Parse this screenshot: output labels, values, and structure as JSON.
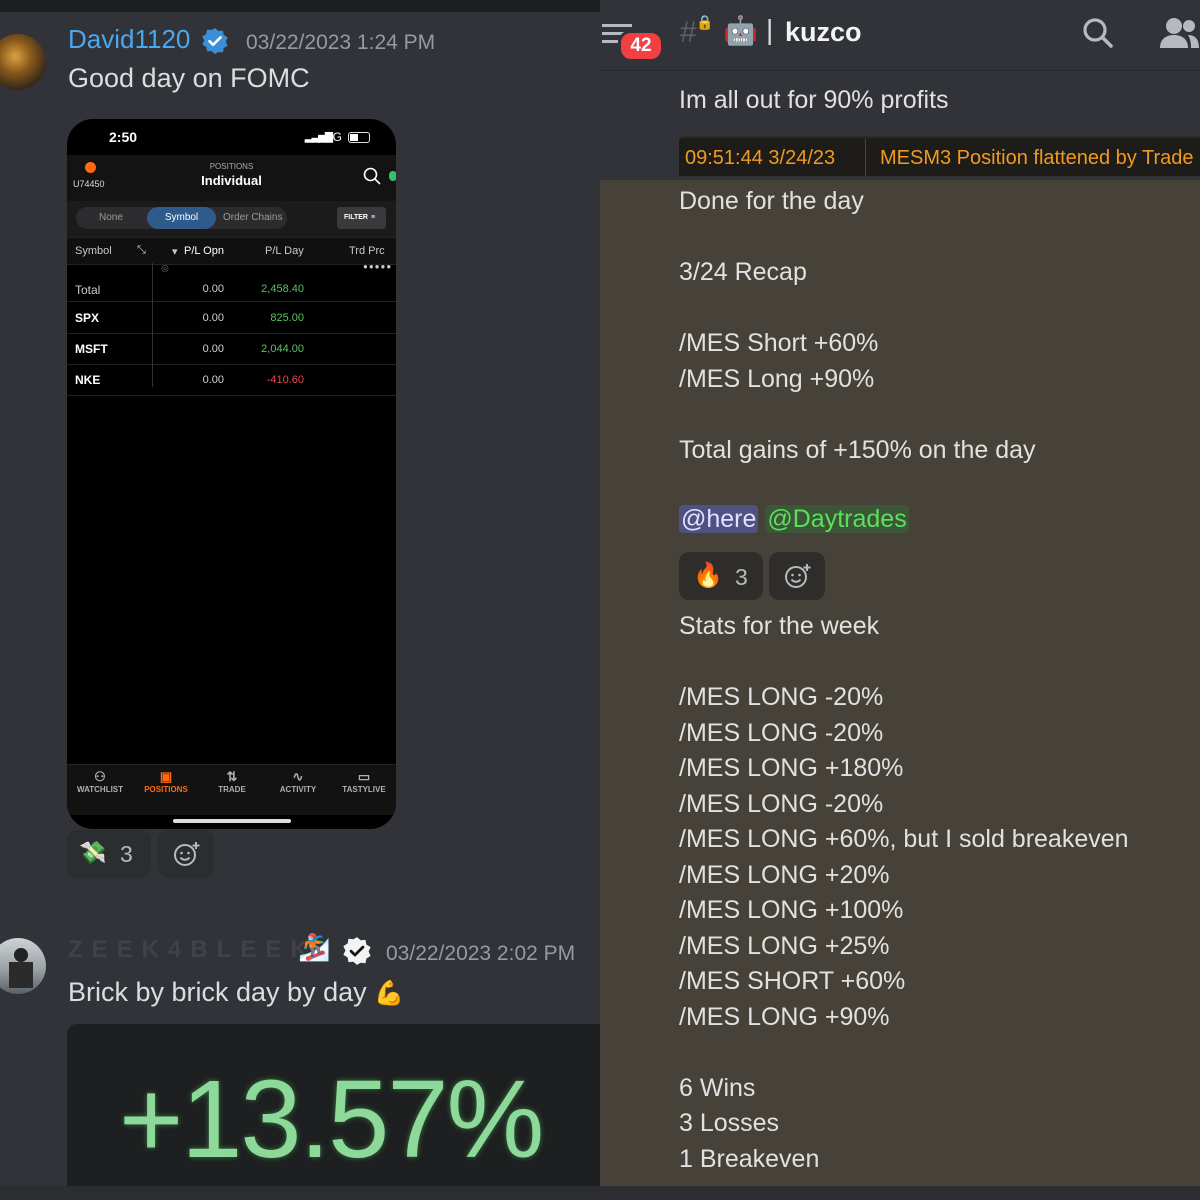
{
  "left": {
    "msg1": {
      "username": "David1120",
      "timestamp": "03/22/2023 1:24 PM",
      "text": "Good day on FOMC",
      "reaction": {
        "emoji": "money-bag",
        "count": "3"
      }
    },
    "phone": {
      "time": "2:50",
      "signal": "5G",
      "account": "U74450",
      "header_small": "POSITIONS",
      "header_title": "Individual",
      "segments": [
        "None",
        "Symbol",
        "Order Chains"
      ],
      "filter": "FILTER",
      "columns": [
        "Symbol",
        "P/L Opn",
        "P/L Day",
        "Trd Prc"
      ],
      "rows": [
        {
          "symbol": "Total",
          "pl_open": "0.00",
          "pl_day": "2,458.40"
        },
        {
          "symbol": "SPX",
          "pl_open": "0.00",
          "pl_day": "825.00"
        },
        {
          "symbol": "MSFT",
          "pl_open": "0.00",
          "pl_day": "2,044.00"
        },
        {
          "symbol": "NKE",
          "pl_open": "0.00",
          "pl_day": "-410.60"
        }
      ],
      "tabs": [
        "WATCHLIST",
        "POSITIONS",
        "TRADE",
        "ACTIVITY",
        "TASTYLIVE"
      ]
    },
    "msg2": {
      "username": "ZEEK4BLEEK",
      "timestamp": "03/22/2023 2:02 PM",
      "text": "Brick by brick day by day",
      "gain": "+13.57%"
    }
  },
  "right": {
    "unread": "42",
    "channel": "kuzco",
    "top_line": "Im all out for 90% profits",
    "strip_time": "09:51:44 3/24/23",
    "strip_text": "MESM3 Position flattened by Trade",
    "lines": [
      "Done for the day",
      "3/24 Recap",
      "/MES Short +60%",
      "/MES Long +90%",
      "Total gains of +150% on the day"
    ],
    "mention_here": "@here",
    "mention_day": "@Daytrades",
    "reaction_count": "3",
    "stats_title": "Stats for the week",
    "stats": [
      "/MES LONG -20%",
      "/MES LONG -20%",
      "/MES LONG +180%",
      "/MES LONG -20%",
      "/MES LONG +60%, but I sold breakeven",
      "/MES LONG +20%",
      "/MES LONG +100%",
      "/MES LONG +25%",
      "/MES SHORT +60%",
      "/MES LONG +90%"
    ],
    "summary": [
      "6 Wins",
      "3 Losses",
      "1 Breakeven"
    ]
  },
  "colors": {
    "username_blue": "#4aa8ee",
    "positive_green": "#5cc25f",
    "negative_red": "#e5484d",
    "orange_text": "#f09a20",
    "unread_badge": "#f23f42"
  }
}
